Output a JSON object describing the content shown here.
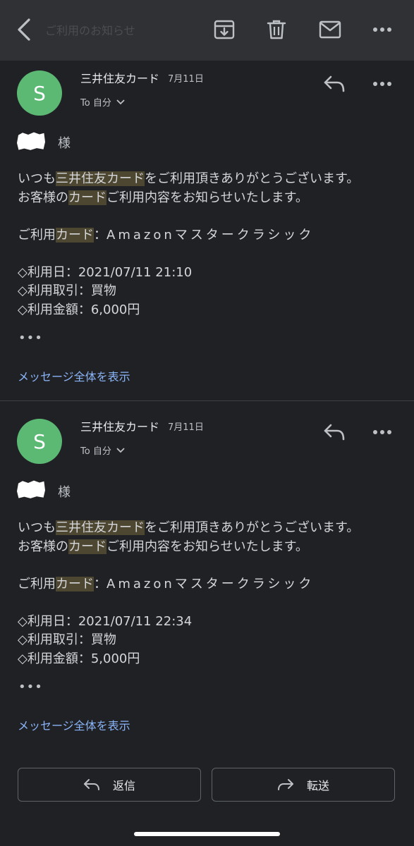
{
  "toolbar": {
    "ghost_subject": "ご利用のお知らせ",
    "icons": [
      "back-icon",
      "archive-icon",
      "delete-icon",
      "mark-unread-icon",
      "more-icon"
    ]
  },
  "messages": [
    {
      "avatar_letter": "S",
      "sender": "三井住友カード",
      "date": "7月11日",
      "to_label": "To 自分",
      "salutation": "様",
      "line1": {
        "a": "いつも",
        "hl": "三井住友カード",
        "b": "をご利用頂きありがとうございます。"
      },
      "line2": {
        "a": "お客様の",
        "hl": "カード",
        "b": "ご利用内容をお知らせいたします。"
      },
      "card_line": {
        "a": "ご利用",
        "hl": "カード",
        "b": "：",
        "card_name": "Amazonマスタークラシック"
      },
      "usage_date": "◇利用日：2021/07/11 21:10",
      "usage_type": "◇利用取引：買物",
      "usage_amount": "◇利用金額：6,000円",
      "ellipsis": "•••",
      "show_all": "メッセージ全体を表示"
    },
    {
      "avatar_letter": "S",
      "sender": "三井住友カード",
      "date": "7月11日",
      "to_label": "To 自分",
      "salutation": "様",
      "line1": {
        "a": "いつも",
        "hl": "三井住友カード",
        "b": "をご利用頂きありがとうございます。"
      },
      "line2": {
        "a": "お客様の",
        "hl": "カード",
        "b": "ご利用内容をお知らせいたします。"
      },
      "card_line": {
        "a": "ご利用",
        "hl": "カード",
        "b": "：",
        "card_name": "Amazonマスタークラシック"
      },
      "usage_date": "◇利用日：2021/07/11 22:34",
      "usage_type": "◇利用取引：買物",
      "usage_amount": "◇利用金額：5,000円",
      "ellipsis": "•••",
      "show_all": "メッセージ全体を表示"
    }
  ],
  "footer": {
    "reply_label": "返信",
    "forward_label": "転送"
  },
  "colors": {
    "background": "#202124",
    "toolbar": "#303134",
    "avatar": "#5bb974",
    "link": "#8ab4f8",
    "highlight": "#4d4630"
  }
}
